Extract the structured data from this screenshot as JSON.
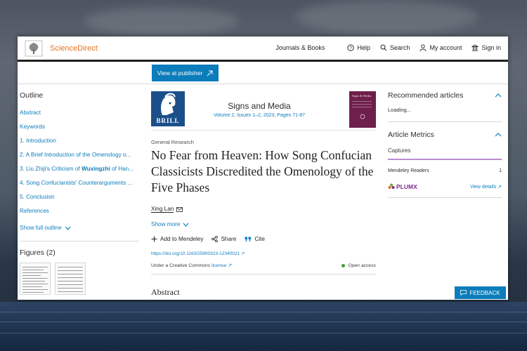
{
  "header": {
    "brand": "ScienceDirect",
    "journals_books": "Journals & Books",
    "help": "Help",
    "search": "Search",
    "my_account": "My account",
    "sign_in": "Sign in"
  },
  "subbar": {
    "view_at_publisher": "View at publisher"
  },
  "outline": {
    "title": "Outline",
    "items": [
      "Abstract",
      "Keywords",
      "1. Introduction",
      "2. A Brief Introduction of the Omenology o...",
      "3. Liu Zhiji's Criticism of",
      "4. Song Confucianists' Counterarguments ...",
      "5. Conclusion",
      "References"
    ],
    "item5_bold": "Wuxingzhi",
    "item5_tail": " of Han...",
    "show_full": "Show full outline"
  },
  "figures": {
    "title": "Figures (2)"
  },
  "journal": {
    "publisher": "BRILL",
    "name": "Signs and Media",
    "volume": "Volume 2, Issues 1–2, 2023, Pages 71-87",
    "cover_title": "Signs & Media"
  },
  "article": {
    "section": "General Research",
    "title": "No Fear from Heaven: How Song Confucian Classicists Discredited the Omenology of the Five Phases",
    "author": "Xing Lan",
    "show_more": "Show more",
    "add_mendeley": "Add to Mendeley",
    "share": "Share",
    "cite": "Cite",
    "doi": "https://doi.org/10.1163/25900323-12340021",
    "license_prefix": "Under a Creative Commons",
    "license_link": "license",
    "open_access": "Open access",
    "abstract_heading": "Abstract"
  },
  "sidebar_right": {
    "recommended": "Recommended articles",
    "loading": "Loading...",
    "metrics": "Article Metrics",
    "captures": "Captures",
    "mendeley_readers_label": "Mendeley Readers",
    "mendeley_readers_value": "1",
    "plumx": "PLUMX",
    "view_details": "View details"
  },
  "feedback": "FEEDBACK",
  "colors": {
    "link": "#0c7dbb",
    "brand": "#e9711c",
    "brill": "#1b4f8a",
    "cover": "#6e1f4b"
  }
}
